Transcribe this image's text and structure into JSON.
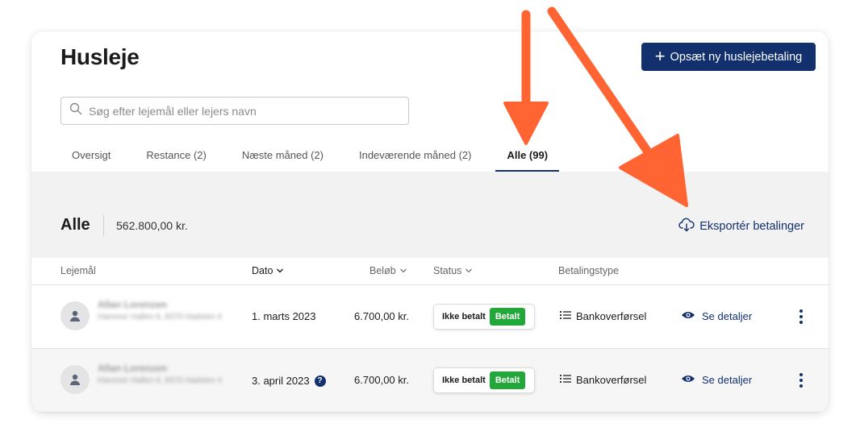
{
  "page": {
    "title": "Husleje",
    "primary_button": "Opsæt ny huslejebetaling"
  },
  "search": {
    "placeholder": "Søg efter lejemål eller lejers navn"
  },
  "tabs": [
    {
      "label": "Oversigt",
      "active": false
    },
    {
      "label": "Restance (2)",
      "active": false
    },
    {
      "label": "Næste måned (2)",
      "active": false
    },
    {
      "label": "Indeværende måned (2)",
      "active": false
    },
    {
      "label": "Alle (99)",
      "active": true
    }
  ],
  "section": {
    "title": "Alle",
    "total": "562.800,00 kr.",
    "export_label": "Eksportér betalinger",
    "export_icon": "cloud-download-icon"
  },
  "table": {
    "columns": {
      "lease": "Lejemål",
      "date": "Dato",
      "amount": "Beløb",
      "status": "Status",
      "payment_type": "Betalingstype"
    },
    "rows": [
      {
        "tenant_name": "Allan Lorenzen",
        "tenant_address": "Hammer Hallen 6, 8370 Hadsten 4",
        "date": "1. marts 2023",
        "amount": "6.700,00 kr.",
        "status_unpaid": "Ikke betalt",
        "status_paid": "Betalt",
        "payment_type": "Bankoverførsel",
        "details": "Se detaljer",
        "has_help": false
      },
      {
        "tenant_name": "Allan Lorenzen",
        "tenant_address": "Hammer Hallen 6, 8370 Hadsten 4",
        "date": "3. april 2023",
        "amount": "6.700,00 kr.",
        "status_unpaid": "Ikke betalt",
        "status_paid": "Betalt",
        "payment_type": "Bankoverførsel",
        "details": "Se detaljer",
        "has_help": true
      }
    ]
  },
  "colors": {
    "brand": "#12306e",
    "paid_green": "#22a838",
    "annotation_arrow": "#ff6432"
  }
}
